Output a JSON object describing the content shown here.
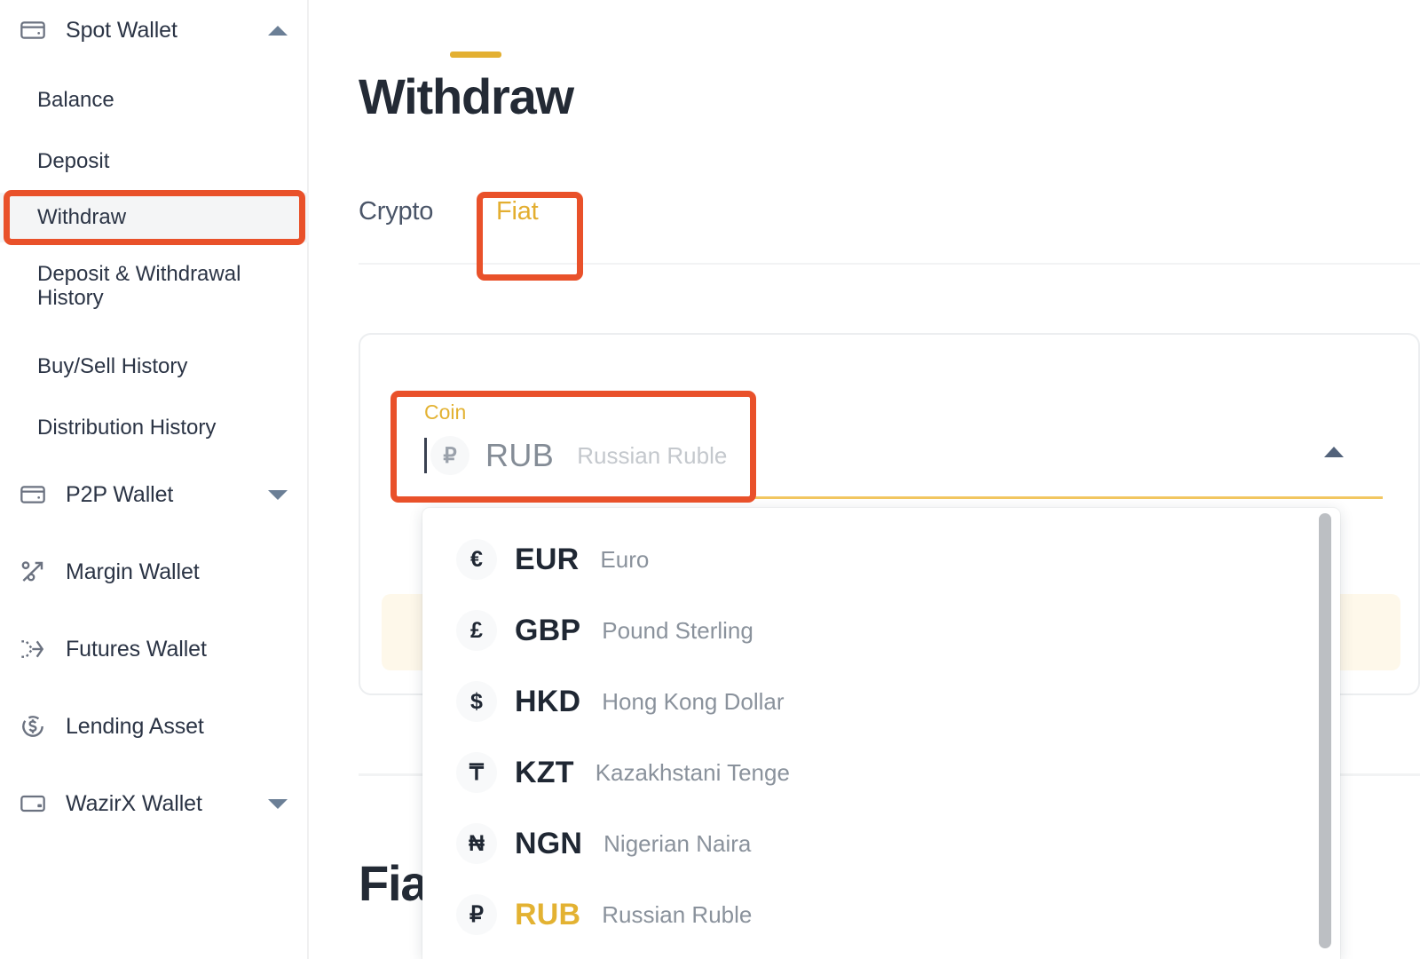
{
  "sidebar": {
    "groups": [
      {
        "label": "Spot Wallet",
        "icon": "wallet-icon",
        "expanded": true,
        "caret": "up",
        "items": [
          {
            "label": "Balance",
            "active": false
          },
          {
            "label": "Deposit",
            "active": false
          },
          {
            "label": "Withdraw",
            "active": true
          },
          {
            "label": "Deposit & Withdrawal History",
            "active": false
          },
          {
            "label": "Buy/Sell History",
            "active": false
          },
          {
            "label": "Distribution History",
            "active": false
          }
        ]
      },
      {
        "label": "P2P Wallet",
        "icon": "wallet-icon",
        "caret": "down",
        "items": []
      },
      {
        "label": "Margin Wallet",
        "icon": "percent-arrow-icon",
        "caret": null,
        "items": []
      },
      {
        "label": "Futures Wallet",
        "icon": "futures-branch-icon",
        "caret": null,
        "items": []
      },
      {
        "label": "Lending Asset",
        "icon": "dollar-circle-icon",
        "caret": null,
        "items": []
      },
      {
        "label": "WazirX Wallet",
        "icon": "card-icon",
        "caret": "down",
        "items": []
      }
    ]
  },
  "main": {
    "page_title": "Withdraw",
    "tabs": [
      {
        "label": "Crypto",
        "active": false
      },
      {
        "label": "Fiat",
        "active": true
      }
    ],
    "coin_field": {
      "label": "Coin",
      "symbol": "₽",
      "code": "RUB",
      "name": "Russian Ruble"
    },
    "bottom_heading": "Fiat"
  },
  "dropdown": {
    "options": [
      {
        "symbol": "€",
        "code": "EUR",
        "name": "Euro",
        "selected": false
      },
      {
        "symbol": "£",
        "code": "GBP",
        "name": "Pound Sterling",
        "selected": false
      },
      {
        "symbol": "$",
        "code": "HKD",
        "name": "Hong Kong Dollar",
        "selected": false
      },
      {
        "symbol": "₸",
        "code": "KZT",
        "name": "Kazakhstani Tenge",
        "selected": false
      },
      {
        "symbol": "₦",
        "code": "NGN",
        "name": "Nigerian Naira",
        "selected": false
      },
      {
        "symbol": "₽",
        "code": "RUB",
        "name": "Russian Ruble",
        "selected": true
      }
    ]
  },
  "annotations": {
    "color": "#E9512A",
    "targets": [
      "sidebar-item-withdraw",
      "tab-fiat",
      "coin-field"
    ]
  },
  "colors": {
    "accent_yellow": "#E3B232",
    "annotation_orange": "#E9512A",
    "text_dark": "#232A35",
    "text_muted": "#8A929C"
  }
}
